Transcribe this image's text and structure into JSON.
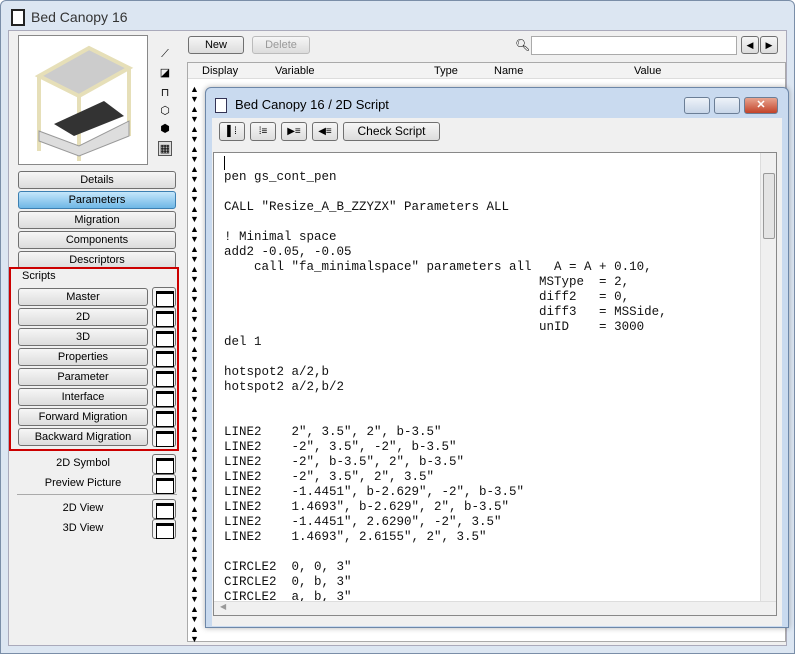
{
  "window": {
    "title": "Bed Canopy 16"
  },
  "left": {
    "tabs": [
      "Details",
      "Parameters",
      "Migration",
      "Components",
      "Descriptors"
    ],
    "selected_tab": "Parameters",
    "scripts_title": "Scripts",
    "scripts": [
      "Master",
      "2D",
      "3D",
      "Properties",
      "Parameter",
      "Interface",
      "Forward Migration",
      "Backward Migration"
    ],
    "extras": [
      "2D Symbol",
      "Preview Picture"
    ],
    "views": [
      "2D View",
      "3D View"
    ]
  },
  "toolbar": {
    "new": "New",
    "delete": "Delete",
    "search_placeholder": ""
  },
  "table": {
    "columns": [
      "Display",
      "Variable",
      "Type",
      "Name",
      "Value"
    ]
  },
  "script_window": {
    "title": "Bed Canopy 16 / 2D Script",
    "check": "Check Script",
    "lines": [
      "",
      "pen gs_cont_pen",
      "",
      "CALL \"Resize_A_B_ZZYZX\" Parameters ALL",
      "",
      "! Minimal space",
      "add2 -0.05, -0.05",
      "    call \"fa_minimalspace\" parameters all   A = A + 0.10,",
      "                                          MSType  = 2,",
      "                                          diff2   = 0,",
      "                                          diff3   = MSSide,",
      "                                          unID    = 3000",
      "del 1",
      "",
      "hotspot2 a/2,b",
      "hotspot2 a/2,b/2",
      "",
      "",
      "LINE2    2\", 3.5\", 2\", b-3.5\"",
      "LINE2    -2\", 3.5\", -2\", b-3.5\"",
      "LINE2    -2\", b-3.5\", 2\", b-3.5\"",
      "LINE2    -2\", 3.5\", 2\", 3.5\"",
      "LINE2    -1.4451\", b-2.629\", -2\", b-3.5\"",
      "LINE2    1.4693\", b-2.629\", 2\", b-3.5\"",
      "LINE2    -1.4451\", 2.6290\", -2\", 3.5\"",
      "LINE2    1.4693\", 2.6155\", 2\", 3.5\"",
      "",
      "CIRCLE2  0, 0, 3\"",
      "CIRCLE2  0, b, 3\"",
      "CIRCLE2  a, b, 3\""
    ]
  }
}
